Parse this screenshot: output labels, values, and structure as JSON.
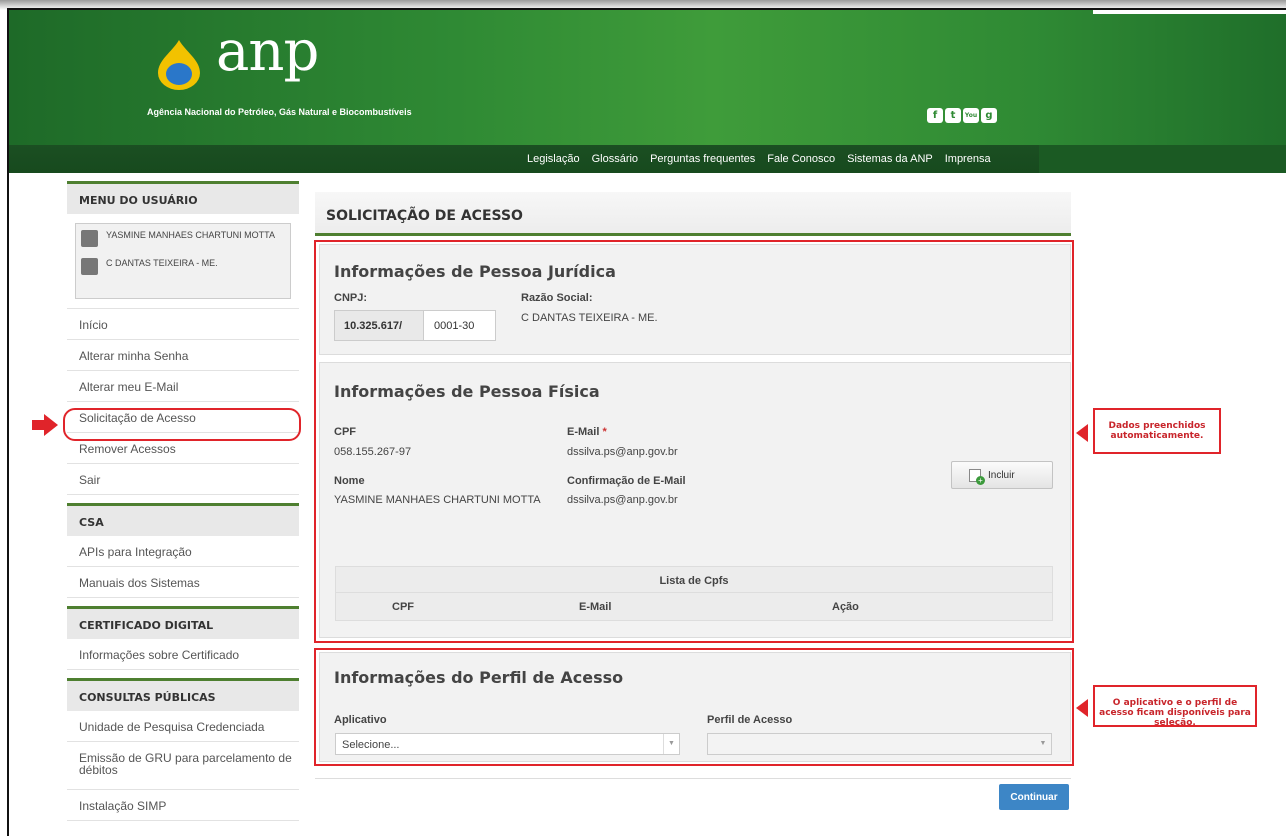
{
  "header": {
    "logo_text": "anp",
    "logo_subtitle": "Agência Nacional do Petróleo, Gás Natural e Biocombustíveis",
    "social": [
      "f",
      "t",
      "You",
      "g"
    ],
    "nav": [
      "Legislação",
      "Glossário",
      "Perguntas frequentes",
      "Fale Conosco",
      "Sistemas da ANP",
      "Imprensa"
    ],
    "colors": {
      "green": "#2f8a34",
      "dark_green": "#1b4f22"
    }
  },
  "sidebar": {
    "user_menu_title": "MENU DO USUÁRIO",
    "user_name": "YASMINE MANHAES CHARTUNI MOTTA",
    "company_name": "C DANTAS TEIXEIRA - ME.",
    "items": [
      "Início",
      "Alterar minha Senha",
      "Alterar meu E-Mail",
      "Solicitação de Acesso",
      "Remover Acessos",
      "Sair"
    ],
    "csa_title": "CSA",
    "csa_items": [
      "APIs para Integração",
      "Manuais dos Sistemas"
    ],
    "cert_title": "CERTIFICADO DIGITAL",
    "cert_items": [
      "Informações sobre Certificado"
    ],
    "consultas_title": "CONSULTAS PÚBLICAS",
    "consultas_items": [
      "Unidade de Pesquisa Credenciada",
      "Emissão de GRU para parcelamento de débitos",
      "Instalação SIMP"
    ]
  },
  "main": {
    "title": "SOLICITAÇÃO DE ACESSO",
    "pj": {
      "heading": "Informações de Pessoa Jurídica",
      "cnpj_label": "CNPJ:",
      "cnpj_part1": "10.325.617/",
      "cnpj_part2": "0001-30",
      "razao_label": "Razão Social:",
      "razao_value": "C DANTAS TEIXEIRA - ME."
    },
    "pf": {
      "heading": "Informações de Pessoa Física",
      "cpf_label": "CPF",
      "cpf_value": "058.155.267-97",
      "email_label": "E-Mail",
      "email_required": "*",
      "email_value": "dssilva.ps@anp.gov.br",
      "nome_label": "Nome",
      "nome_value": "YASMINE MANHAES CHARTUNI MOTTA",
      "confirm_label": "Confirmação de E-Mail",
      "confirm_value": "dssilva.ps@anp.gov.br",
      "incluir_label": "Incluir",
      "table_title": "Lista de Cpfs",
      "table_headers": [
        "CPF",
        "E-Mail",
        "Ação"
      ]
    },
    "perfil": {
      "heading": "Informações do Perfil de Acesso",
      "aplicativo_label": "Aplicativo",
      "aplicativo_value": "Selecione...",
      "perfil_label": "Perfil de Acesso",
      "perfil_value": ""
    },
    "continuar_label": "Continuar"
  },
  "annotations": {
    "callout1": "Dados preenchidos automaticamente.",
    "callout2": "O aplicativo e o perfil de acesso ficam disponíveis para seleção.",
    "highlight_color": "#e0242a"
  }
}
